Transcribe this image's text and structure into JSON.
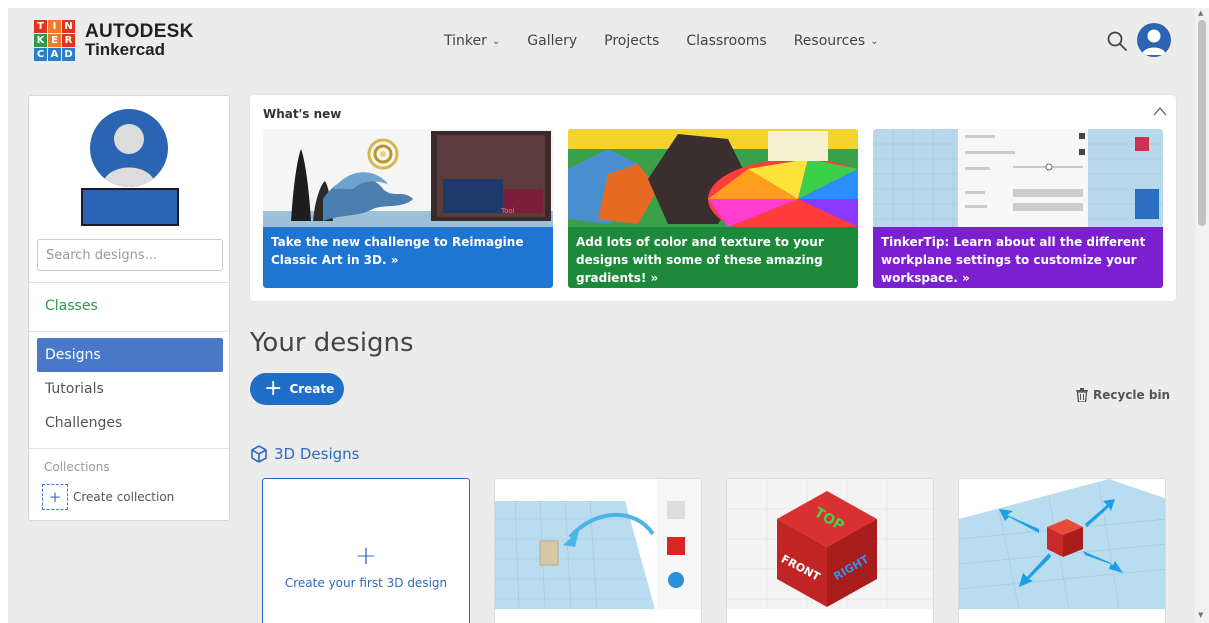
{
  "header": {
    "logo_letters": [
      "T",
      "I",
      "N",
      "K",
      "E",
      "R",
      "C",
      "A",
      "D"
    ],
    "brand": "AUTODESK",
    "product": "Tinkercad",
    "nav": [
      {
        "label": "Tinker",
        "dropdown": true
      },
      {
        "label": "Gallery",
        "dropdown": false
      },
      {
        "label": "Projects",
        "dropdown": false
      },
      {
        "label": "Classrooms",
        "dropdown": false
      },
      {
        "label": "Resources",
        "dropdown": true
      }
    ],
    "search_icon": "search-icon",
    "avatar_icon": "user-avatar"
  },
  "sidebar": {
    "search_placeholder": "Search designs...",
    "classes_label": "Classes",
    "items": [
      {
        "label": "Designs",
        "active": true
      },
      {
        "label": "Tutorials",
        "active": false
      },
      {
        "label": "Challenges",
        "active": false
      }
    ],
    "collections_label": "Collections",
    "create_collection_label": "Create collection"
  },
  "whats_new": {
    "title": "What's new",
    "cards": [
      {
        "caption": "Take the new challenge to Reimagine Classic Art in 3D. »",
        "color": "#1e76d2"
      },
      {
        "caption": "Add lots of color and texture to your designs with some of these amazing gradients! »",
        "color": "#1c8a3a"
      },
      {
        "caption": "TinkerTip: Learn about all the different workplane settings to customize your workspace. »",
        "color": "#7b1fd1"
      }
    ]
  },
  "designs": {
    "title": "Your designs",
    "create_label": "Create",
    "recycle_label": "Recycle bin",
    "section_label": "3D Designs",
    "first_tile_label": "Create your first 3D design",
    "cube_labels": [
      "TOP",
      "FRONT",
      "RIGHT"
    ]
  },
  "colors": {
    "accent": "#1f6fc9",
    "active_nav": "#4a78c9",
    "classes_green": "#2d9b4a"
  }
}
